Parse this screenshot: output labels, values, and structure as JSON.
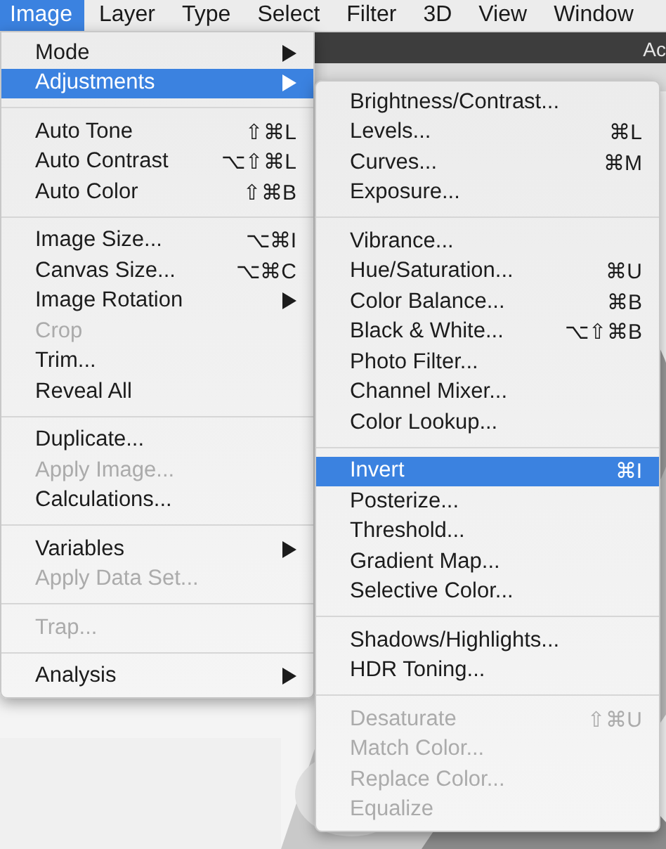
{
  "menubar": [
    {
      "label": "Image",
      "selected": true
    },
    {
      "label": "Layer",
      "selected": false
    },
    {
      "label": "Type",
      "selected": false
    },
    {
      "label": "Select",
      "selected": false
    },
    {
      "label": "Filter",
      "selected": false
    },
    {
      "label": "3D",
      "selected": false
    },
    {
      "label": "View",
      "selected": false
    },
    {
      "label": "Window",
      "selected": false
    }
  ],
  "panel_title": "Ac",
  "menu": {
    "items": [
      {
        "kind": "item",
        "label": "Mode",
        "disabled": false,
        "selected": false,
        "submenu": true
      },
      {
        "kind": "item",
        "label": "Adjustments",
        "disabled": false,
        "selected": true,
        "submenu": true
      },
      {
        "kind": "separator"
      },
      {
        "kind": "item",
        "label": "Auto Tone",
        "shortcut": "⇧⌘L",
        "disabled": false,
        "selected": false,
        "submenu": false
      },
      {
        "kind": "item",
        "label": "Auto Contrast",
        "shortcut": "⌥⇧⌘L",
        "disabled": false,
        "selected": false,
        "submenu": false
      },
      {
        "kind": "item",
        "label": "Auto Color",
        "shortcut": "⇧⌘B",
        "disabled": false,
        "selected": false,
        "submenu": false
      },
      {
        "kind": "separator"
      },
      {
        "kind": "item",
        "label": "Image Size...",
        "shortcut": "⌥⌘I",
        "disabled": false,
        "selected": false,
        "submenu": false
      },
      {
        "kind": "item",
        "label": "Canvas Size...",
        "shortcut": "⌥⌘C",
        "disabled": false,
        "selected": false,
        "submenu": false
      },
      {
        "kind": "item",
        "label": "Image Rotation",
        "disabled": false,
        "selected": false,
        "submenu": true
      },
      {
        "kind": "item",
        "label": "Crop",
        "disabled": true,
        "selected": false,
        "submenu": false
      },
      {
        "kind": "item",
        "label": "Trim...",
        "disabled": false,
        "selected": false,
        "submenu": false
      },
      {
        "kind": "item",
        "label": "Reveal All",
        "disabled": false,
        "selected": false,
        "submenu": false
      },
      {
        "kind": "separator"
      },
      {
        "kind": "item",
        "label": "Duplicate...",
        "disabled": false,
        "selected": false,
        "submenu": false
      },
      {
        "kind": "item",
        "label": "Apply Image...",
        "disabled": true,
        "selected": false,
        "submenu": false
      },
      {
        "kind": "item",
        "label": "Calculations...",
        "disabled": false,
        "selected": false,
        "submenu": false
      },
      {
        "kind": "separator"
      },
      {
        "kind": "item",
        "label": "Variables",
        "disabled": false,
        "selected": false,
        "submenu": true
      },
      {
        "kind": "item",
        "label": "Apply Data Set...",
        "disabled": true,
        "selected": false,
        "submenu": false
      },
      {
        "kind": "separator"
      },
      {
        "kind": "item",
        "label": "Trap...",
        "disabled": true,
        "selected": false,
        "submenu": false
      },
      {
        "kind": "separator"
      },
      {
        "kind": "item",
        "label": "Analysis",
        "disabled": false,
        "selected": false,
        "submenu": true
      }
    ]
  },
  "submenu": {
    "items": [
      {
        "kind": "item",
        "label": "Brightness/Contrast...",
        "disabled": false,
        "selected": false,
        "submenu": false
      },
      {
        "kind": "item",
        "label": "Levels...",
        "shortcut": "⌘L",
        "disabled": false,
        "selected": false,
        "submenu": false
      },
      {
        "kind": "item",
        "label": "Curves...",
        "shortcut": "⌘M",
        "disabled": false,
        "selected": false,
        "submenu": false
      },
      {
        "kind": "item",
        "label": "Exposure...",
        "disabled": false,
        "selected": false,
        "submenu": false
      },
      {
        "kind": "separator"
      },
      {
        "kind": "item",
        "label": "Vibrance...",
        "disabled": false,
        "selected": false,
        "submenu": false
      },
      {
        "kind": "item",
        "label": "Hue/Saturation...",
        "shortcut": "⌘U",
        "disabled": false,
        "selected": false,
        "submenu": false
      },
      {
        "kind": "item",
        "label": "Color Balance...",
        "shortcut": "⌘B",
        "disabled": false,
        "selected": false,
        "submenu": false
      },
      {
        "kind": "item",
        "label": "Black & White...",
        "shortcut": "⌥⇧⌘B",
        "disabled": false,
        "selected": false,
        "submenu": false
      },
      {
        "kind": "item",
        "label": "Photo Filter...",
        "disabled": false,
        "selected": false,
        "submenu": false
      },
      {
        "kind": "item",
        "label": "Channel Mixer...",
        "disabled": false,
        "selected": false,
        "submenu": false
      },
      {
        "kind": "item",
        "label": "Color Lookup...",
        "disabled": false,
        "selected": false,
        "submenu": false
      },
      {
        "kind": "separator"
      },
      {
        "kind": "item",
        "label": "Invert",
        "shortcut": "⌘I",
        "disabled": false,
        "selected": true,
        "submenu": false
      },
      {
        "kind": "item",
        "label": "Posterize...",
        "disabled": false,
        "selected": false,
        "submenu": false
      },
      {
        "kind": "item",
        "label": "Threshold...",
        "disabled": false,
        "selected": false,
        "submenu": false
      },
      {
        "kind": "item",
        "label": "Gradient Map...",
        "disabled": false,
        "selected": false,
        "submenu": false
      },
      {
        "kind": "item",
        "label": "Selective Color...",
        "disabled": false,
        "selected": false,
        "submenu": false
      },
      {
        "kind": "separator"
      },
      {
        "kind": "item",
        "label": "Shadows/Highlights...",
        "disabled": false,
        "selected": false,
        "submenu": false
      },
      {
        "kind": "item",
        "label": "HDR Toning...",
        "disabled": false,
        "selected": false,
        "submenu": false
      },
      {
        "kind": "separator"
      },
      {
        "kind": "item",
        "label": "Desaturate",
        "shortcut": "⇧⌘U",
        "disabled": true,
        "selected": false,
        "submenu": false
      },
      {
        "kind": "item",
        "label": "Match Color...",
        "disabled": true,
        "selected": false,
        "submenu": false
      },
      {
        "kind": "item",
        "label": "Replace Color...",
        "disabled": true,
        "selected": false,
        "submenu": false
      },
      {
        "kind": "item",
        "label": "Equalize",
        "disabled": true,
        "selected": false,
        "submenu": false
      }
    ]
  }
}
